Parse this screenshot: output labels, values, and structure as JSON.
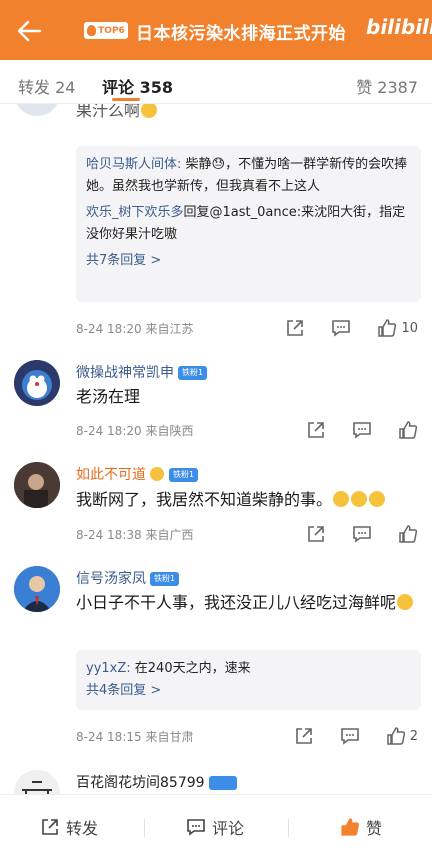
{
  "header": {
    "title": "日本核污染水排海正式开始",
    "tag_label": "TOP6",
    "brand": "bilibili",
    "colors": {
      "bar": "#f2812e"
    }
  },
  "tabs": {
    "repost": "转发 24",
    "comment": "评论 358",
    "like": "赞 2387"
  },
  "comments": [
    {
      "partial_text": "果汁么啊",
      "replies": [
        {
          "who": "哈贝马斯人间体:",
          "text": " 柴静😓，不懂为啥一群学新传的会吹捧她。虽然我也学新传，但我真看不上这人"
        },
        {
          "who": "欢乐_树下欢乐多",
          "text": "回复@1ast_0ance:来沈阳大街，指定没你好果汁吃嗷"
        }
      ],
      "more": "共7条回复 >",
      "time": "8-24 18:20 来自江苏",
      "likes": "10"
    },
    {
      "user": "微操战神常凯申",
      "badge": "铁粉1",
      "text": "老汤在理",
      "time": "8-24 18:20 来自陕西"
    },
    {
      "user": "如此不可道",
      "badge": "铁粉1",
      "text": "我断网了，我居然不知道柴静的事。",
      "time": "8-24 18:38 来自广西"
    },
    {
      "user": "信号汤家凤",
      "badge": "铁粉1",
      "text": "小日子不干人事，我还没正儿八经吃过海鲜呢",
      "replies": [
        {
          "who": "yy1xZ:",
          "text": " 在240天之内，速来"
        }
      ],
      "more": "共4条回复 >",
      "time": "8-24 18:15 来自甘肃",
      "likes": "2"
    },
    {
      "user": "百花阁花坊间85799"
    }
  ],
  "bottom": {
    "repost": "转发",
    "comment": "评论",
    "like": "赞"
  },
  "icons": {
    "back": "arrow-left-icon",
    "share": "share-icon",
    "comment": "comment-icon",
    "like": "thumb-up-icon"
  }
}
